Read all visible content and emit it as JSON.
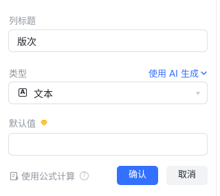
{
  "column_title": {
    "label": "列标题",
    "value": "版次"
  },
  "type": {
    "label": "类型",
    "ai_generate_label": "使用 AI 生成",
    "selected_value": "文本",
    "icon": "text-type-icon",
    "icon_glyph": "A"
  },
  "default_value": {
    "label": "默认值",
    "value": "",
    "badge_icon": "premium-diamond-icon"
  },
  "footer": {
    "formula_label": "使用公式计算",
    "help_glyph": "?",
    "confirm_label": "确认",
    "cancel_label": "取消"
  },
  "colors": {
    "accent": "#3370ff",
    "label": "#8f959e",
    "badge": "#f7b500"
  }
}
